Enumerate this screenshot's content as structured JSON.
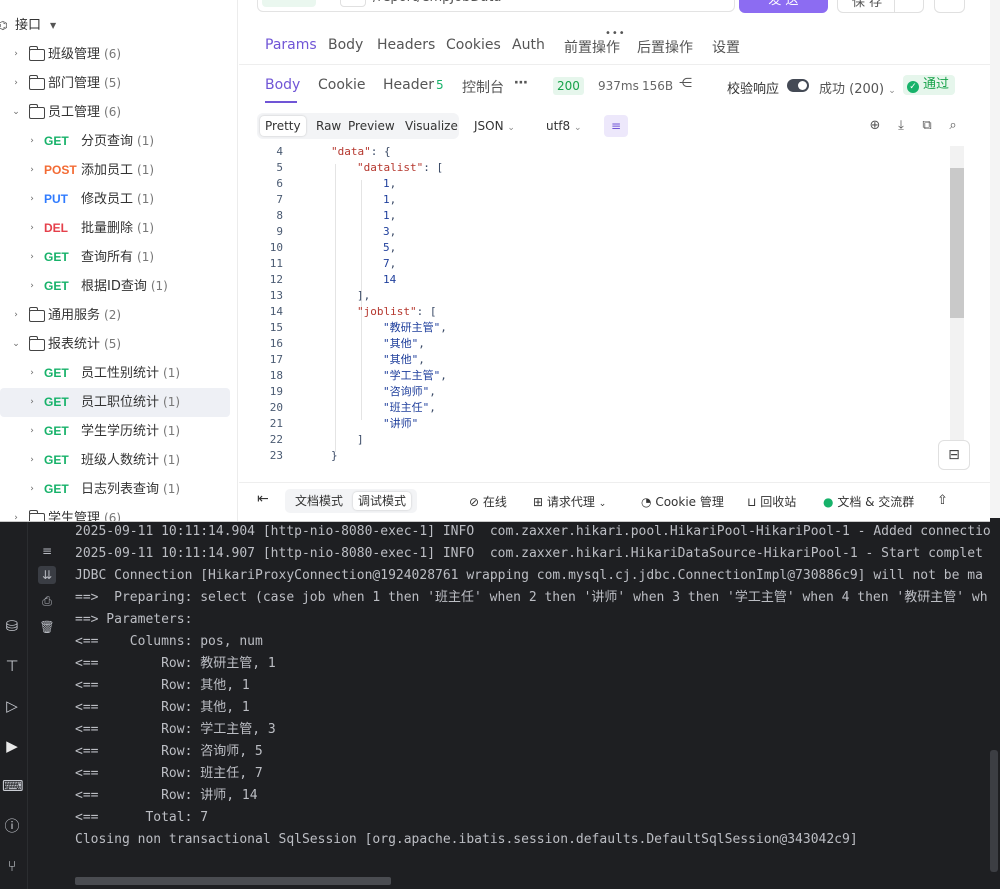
{
  "ide": {
    "console_lines": [
      "2025-09-11 10:11:14.904 [http-nio-8080-exec-1] INFO  com.zaxxer.hikari.pool.HikariPool-HikariPool-1 - Added connectio",
      "2025-09-11 10:11:14.907 [http-nio-8080-exec-1] INFO  com.zaxxer.hikari.HikariDataSource-HikariPool-1 - Start complet",
      "JDBC Connection [HikariProxyConnection@1924028761 wrapping com.mysql.cj.jdbc.ConnectionImpl@730886c9] will not be ma",
      "==>  Preparing: select (case job when 1 then '班主任' when 2 then '讲师' when 3 then '学工主管' when 4 then '教研主管' wh",
      "==> Parameters: ",
      "<==    Columns: pos, num",
      "<==        Row: 教研主管, 1",
      "<==        Row: 其他, 1",
      "<==        Row: 其他, 1",
      "<==        Row: 学工主管, 3",
      "<==        Row: 咨询师, 5",
      "<==        Row: 班主任, 7",
      "<==        Row: 讲师, 14",
      "<==      Total: 7",
      "Closing non transactional SqlSession [org.apache.ibatis.session.defaults.DefaultSqlSession@343042c9]"
    ]
  },
  "sidebar": {
    "root_label": "接口",
    "items": [
      {
        "type": "folder",
        "label": "班级管理",
        "count": "(6)",
        "expanded": false
      },
      {
        "type": "folder",
        "label": "部门管理",
        "count": "(5)",
        "expanded": false
      },
      {
        "type": "folder",
        "label": "员工管理",
        "count": "(6)",
        "expanded": true
      },
      {
        "type": "api",
        "method": "GET",
        "label": "分页查询",
        "count": "(1)"
      },
      {
        "type": "api",
        "method": "POST",
        "label": "添加员工",
        "count": "(1)"
      },
      {
        "type": "api",
        "method": "PUT",
        "label": "修改员工",
        "count": "(1)"
      },
      {
        "type": "api",
        "method": "DEL",
        "label": "批量删除",
        "count": "(1)"
      },
      {
        "type": "api",
        "method": "GET",
        "label": "查询所有",
        "count": "(1)"
      },
      {
        "type": "api",
        "method": "GET",
        "label": "根据ID查询",
        "count": "(1)"
      },
      {
        "type": "folder",
        "label": "通用服务",
        "count": "(2)",
        "expanded": false
      },
      {
        "type": "folder",
        "label": "报表统计",
        "count": "(5)",
        "expanded": true
      },
      {
        "type": "api",
        "method": "GET",
        "label": "员工性别统计",
        "count": "(1)"
      },
      {
        "type": "api",
        "method": "GET",
        "label": "员工职位统计",
        "count": "(1)",
        "active": true
      },
      {
        "type": "api",
        "method": "GET",
        "label": "学生学历统计",
        "count": "(1)"
      },
      {
        "type": "api",
        "method": "GET",
        "label": "班级人数统计",
        "count": "(1)"
      },
      {
        "type": "api",
        "method": "GET",
        "label": "日志列表查询",
        "count": "(1)"
      },
      {
        "type": "folder",
        "label": "学生管理",
        "count": "(6)",
        "expanded": false
      }
    ]
  },
  "request": {
    "method": "GET",
    "url": "/report/empJobData",
    "send_label": "发 送",
    "save_label": "保 存",
    "tabs": [
      "Params",
      "Body",
      "Headers",
      "Cookies",
      "Auth",
      "前置操作",
      "后置操作",
      "设置"
    ]
  },
  "response": {
    "tabs": [
      "Body",
      "Cookie",
      "Header",
      "控制台"
    ],
    "header_count": "5",
    "status": "200",
    "time": "937ms",
    "size": "156B",
    "validate_label": "校验响应",
    "success_label": "成功 (200)",
    "pass_label": "通过",
    "format_buttons": [
      "Pretty",
      "Raw",
      "Preview",
      "Visualize"
    ],
    "format": "JSON",
    "encoding": "utf8"
  },
  "code": {
    "lines": [
      {
        "n": "4",
        "indent": 0,
        "k": "\"data\"",
        "rest": ": {"
      },
      {
        "n": "5",
        "indent": 1,
        "k": "\"datalist\"",
        "rest": ": ["
      },
      {
        "n": "6",
        "indent": 2,
        "v": "1",
        "rest": ","
      },
      {
        "n": "7",
        "indent": 2,
        "v": "1",
        "rest": ","
      },
      {
        "n": "8",
        "indent": 2,
        "v": "1",
        "rest": ","
      },
      {
        "n": "9",
        "indent": 2,
        "v": "3",
        "rest": ","
      },
      {
        "n": "10",
        "indent": 2,
        "v": "5",
        "rest": ","
      },
      {
        "n": "11",
        "indent": 2,
        "v": "7",
        "rest": ","
      },
      {
        "n": "12",
        "indent": 2,
        "v": "14",
        "rest": ""
      },
      {
        "n": "13",
        "indent": 1,
        "rest": "],"
      },
      {
        "n": "14",
        "indent": 1,
        "k": "\"joblist\"",
        "rest": ": ["
      },
      {
        "n": "15",
        "indent": 2,
        "v": "\"教研主管\"",
        "rest": ","
      },
      {
        "n": "16",
        "indent": 2,
        "v": "\"其他\"",
        "rest": ","
      },
      {
        "n": "17",
        "indent": 2,
        "v": "\"其他\"",
        "rest": ","
      },
      {
        "n": "18",
        "indent": 2,
        "v": "\"学工主管\"",
        "rest": ","
      },
      {
        "n": "19",
        "indent": 2,
        "v": "\"咨询师\"",
        "rest": ","
      },
      {
        "n": "20",
        "indent": 2,
        "v": "\"班主任\"",
        "rest": ","
      },
      {
        "n": "21",
        "indent": 2,
        "v": "\"讲师\"",
        "rest": ""
      },
      {
        "n": "22",
        "indent": 1,
        "rest": "]"
      },
      {
        "n": "23",
        "indent": 0,
        "rest": "}"
      }
    ]
  },
  "bottom_bar": {
    "doc_mode": "文档模式",
    "debug_mode": "调试模式",
    "online": "在线",
    "proxy": "请求代理",
    "cookie": "Cookie 管理",
    "recycle": "回收站",
    "community": "文档 & 交流群"
  },
  "colors": {
    "accent": "#7055d6",
    "get": "#17b26a",
    "post": "#f36b34",
    "put": "#2f7bff",
    "del": "#e5404b"
  }
}
